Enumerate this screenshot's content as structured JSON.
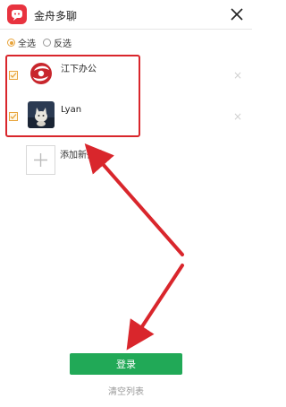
{
  "window": {
    "title": "金舟多聊",
    "logo_icon": "chat-bubble-icon",
    "close_icon": "close-icon"
  },
  "selection": {
    "select_all_label": "全选",
    "invert_label": "反选",
    "select_all_checked": true
  },
  "accounts": [
    {
      "name": "江下办公",
      "checked": true,
      "avatar_icon": "red-swirl-logo"
    },
    {
      "name": "Lyan",
      "checked": true,
      "avatar_icon": "cat-photo"
    }
  ],
  "add_account": {
    "label": "添加新微信"
  },
  "actions": {
    "login_label": "登录",
    "clear_label": "清空列表"
  },
  "colors": {
    "accent_orange": "#e8a43b",
    "login_green": "#21a957",
    "annotation_red": "#d9262c",
    "logo_red": "#e8333f"
  }
}
